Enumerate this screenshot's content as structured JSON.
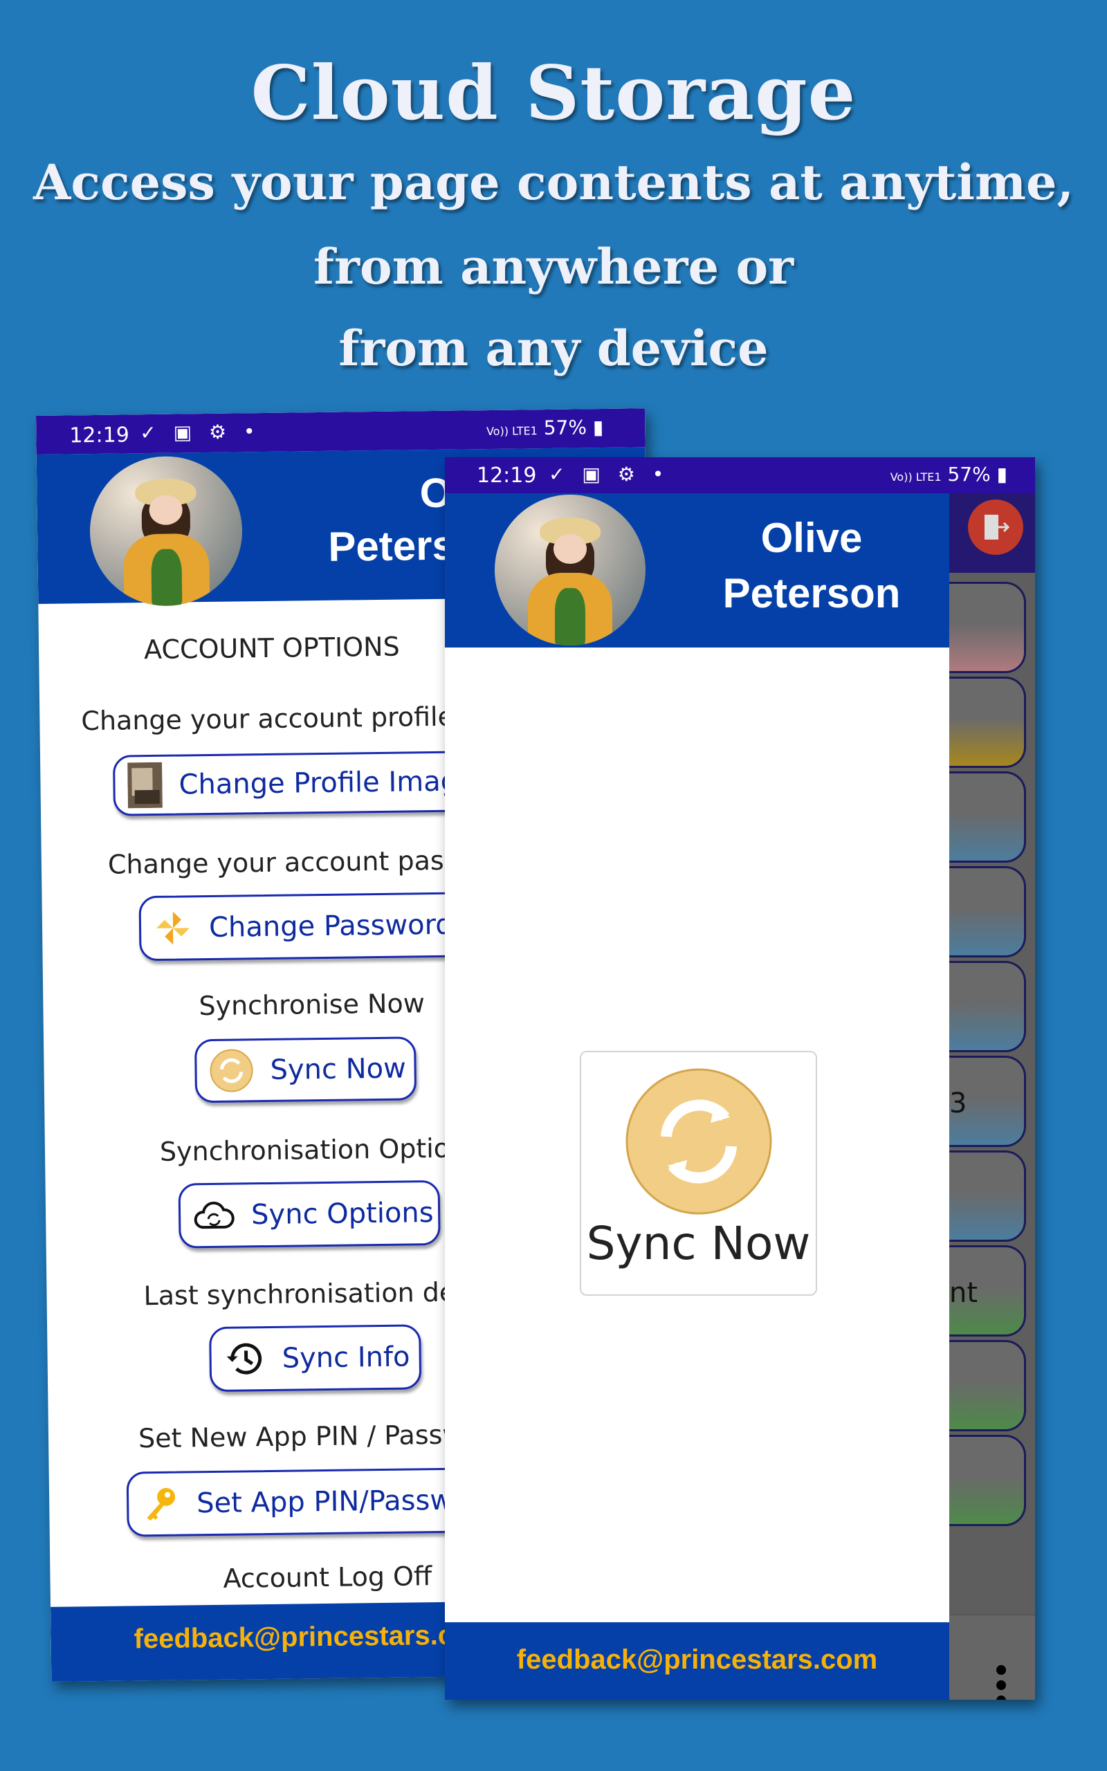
{
  "hero": {
    "title": "Cloud Storage",
    "lines": [
      "Access your page contents at anytime,",
      "from anywhere or",
      "from any device"
    ]
  },
  "status": {
    "time": "12:19",
    "left_icons": "✓ ▣ ⚙ •",
    "network": "Vo)) LTE1",
    "battery": "57%"
  },
  "profile": {
    "first_name": "Olive",
    "last_name": "Peterson"
  },
  "account_options": {
    "heading": "ACCOUNT OPTIONS",
    "sections": [
      {
        "label": "Change your account profile",
        "button": "Change Profile Image",
        "icon": "image-thumbnail-icon"
      },
      {
        "label": "Change your account password",
        "button": "Change Password",
        "icon": "pinwheel-icon"
      },
      {
        "label": "Synchronise Now",
        "button": "Sync Now",
        "icon": "sync-icon"
      },
      {
        "label": "Synchronisation Options",
        "button": "Sync Options",
        "icon": "cloud-sync-icon"
      },
      {
        "label": "Last synchronisation details",
        "button": "Sync Info",
        "icon": "history-icon"
      },
      {
        "label": "Set New App PIN / Password",
        "button": "Set App PIN/Password",
        "icon": "key-icon"
      }
    ],
    "logoff": "Account Log Off"
  },
  "footer": {
    "email": "feedback@princestars.com"
  },
  "sync_dialog": {
    "label": "Sync Now",
    "icon": "sync-icon",
    "icon_color": "#f2cd85"
  },
  "background_list": {
    "partial_texts": [
      "3",
      "nt"
    ]
  },
  "colors": {
    "background": "#2179b9",
    "status_bar": "#2a0ea0",
    "header": "#0440a8",
    "footer_text": "#f6b10a",
    "logout": "#c0392b"
  }
}
